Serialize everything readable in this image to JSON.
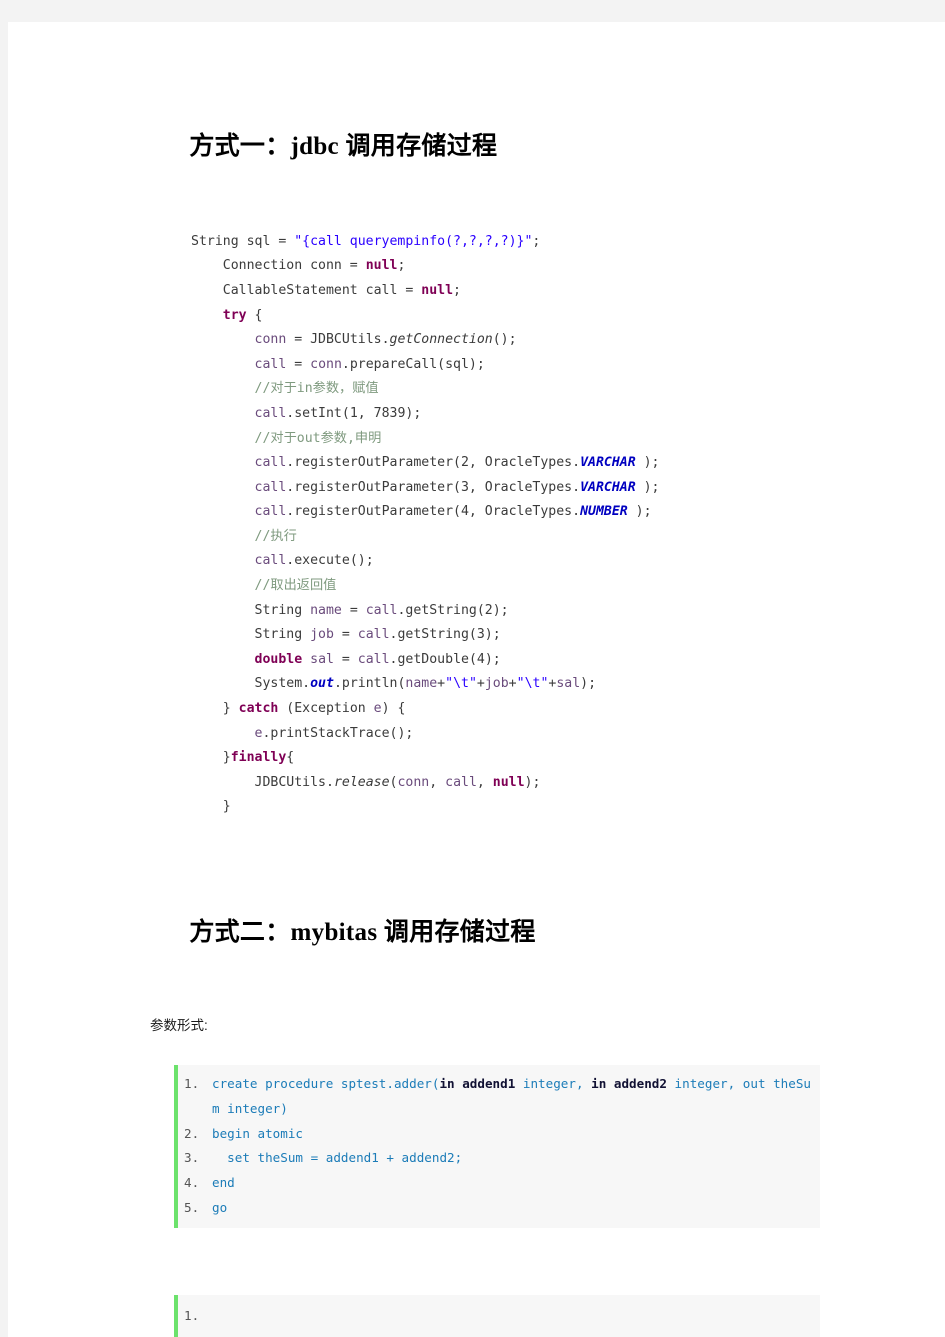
{
  "document": {
    "background_color": "#f3f3f3",
    "page_color": "#ffffff"
  },
  "headings": {
    "heading_1_prefix": "方式一：",
    "heading_1_code": "jdbc",
    "heading_1_suffix": " 调用存储过程",
    "heading_2_prefix": "方式二：",
    "heading_2_code": "mybitas",
    "heading_2_suffix": " 调用存储过程"
  },
  "paragraphs": {
    "params_label": "参数形式:"
  },
  "java_block": {
    "language": "java",
    "lines": [
      {
        "indent": 0,
        "tokens": [
          {
            "t": "String sql = ",
            "c": "plain"
          },
          {
            "t": "\"{call queryempinfo(?,?,?,?)}\"",
            "c": "str"
          },
          {
            "t": ";",
            "c": "plain"
          }
        ]
      },
      {
        "indent": 1,
        "tokens": [
          {
            "t": "Connection conn = ",
            "c": "plain"
          },
          {
            "t": "null",
            "c": "kw"
          },
          {
            "t": ";",
            "c": "plain"
          }
        ]
      },
      {
        "indent": 1,
        "tokens": [
          {
            "t": "CallableStatement call = ",
            "c": "plain"
          },
          {
            "t": "null",
            "c": "kw"
          },
          {
            "t": ";",
            "c": "plain"
          }
        ]
      },
      {
        "indent": 1,
        "tokens": [
          {
            "t": "try",
            "c": "kw"
          },
          {
            "t": " {",
            "c": "plain"
          }
        ]
      },
      {
        "indent": 2,
        "tokens": [
          {
            "t": "conn",
            "c": "lvar"
          },
          {
            "t": " = JDBCUtils.",
            "c": "plain"
          },
          {
            "t": "getConnection",
            "c": "mth"
          },
          {
            "t": "();",
            "c": "plain"
          }
        ]
      },
      {
        "indent": 2,
        "tokens": [
          {
            "t": "call",
            "c": "lvar"
          },
          {
            "t": " = ",
            "c": "plain"
          },
          {
            "t": "conn",
            "c": "lvar"
          },
          {
            "t": ".prepareCall(sql);",
            "c": "plain"
          }
        ]
      },
      {
        "indent": 2,
        "tokens": [
          {
            "t": "//对于in参数，赋值",
            "c": "cmt"
          }
        ]
      },
      {
        "indent": 2,
        "tokens": [
          {
            "t": "call",
            "c": "lvar"
          },
          {
            "t": ".setInt(1, 7839);",
            "c": "plain"
          }
        ]
      },
      {
        "indent": 2,
        "tokens": [
          {
            "t": "//对于out参数,申明",
            "c": "cmt"
          }
        ]
      },
      {
        "indent": 2,
        "tokens": [
          {
            "t": "call",
            "c": "lvar"
          },
          {
            "t": ".registerOutParameter(2, OracleTypes.",
            "c": "plain"
          },
          {
            "t": "VARCHAR",
            "c": "stat"
          },
          {
            "t": " );",
            "c": "plain"
          }
        ]
      },
      {
        "indent": 2,
        "tokens": [
          {
            "t": "call",
            "c": "lvar"
          },
          {
            "t": ".registerOutParameter(3, OracleTypes.",
            "c": "plain"
          },
          {
            "t": "VARCHAR",
            "c": "stat"
          },
          {
            "t": " );",
            "c": "plain"
          }
        ]
      },
      {
        "indent": 2,
        "tokens": [
          {
            "t": "call",
            "c": "lvar"
          },
          {
            "t": ".registerOutParameter(4, OracleTypes.",
            "c": "plain"
          },
          {
            "t": "NUMBER",
            "c": "stat"
          },
          {
            "t": " );",
            "c": "plain"
          }
        ]
      },
      {
        "indent": 2,
        "tokens": [
          {
            "t": "//执行",
            "c": "cmt"
          }
        ]
      },
      {
        "indent": 2,
        "tokens": [
          {
            "t": "call",
            "c": "lvar"
          },
          {
            "t": ".execute();",
            "c": "plain"
          }
        ]
      },
      {
        "indent": 2,
        "tokens": [
          {
            "t": "//取出返回值",
            "c": "cmt"
          }
        ]
      },
      {
        "indent": 2,
        "tokens": [
          {
            "t": "String ",
            "c": "plain"
          },
          {
            "t": "name",
            "c": "lvar"
          },
          {
            "t": " = ",
            "c": "plain"
          },
          {
            "t": "call",
            "c": "lvar"
          },
          {
            "t": ".getString(2);",
            "c": "plain"
          }
        ]
      },
      {
        "indent": 2,
        "tokens": [
          {
            "t": "String ",
            "c": "plain"
          },
          {
            "t": "job",
            "c": "lvar"
          },
          {
            "t": " = ",
            "c": "plain"
          },
          {
            "t": "call",
            "c": "lvar"
          },
          {
            "t": ".getString(3);",
            "c": "plain"
          }
        ]
      },
      {
        "indent": 2,
        "tokens": [
          {
            "t": "double",
            "c": "kw"
          },
          {
            "t": " ",
            "c": "plain"
          },
          {
            "t": "sal",
            "c": "lvar"
          },
          {
            "t": " = ",
            "c": "plain"
          },
          {
            "t": "call",
            "c": "lvar"
          },
          {
            "t": ".getDouble(4);",
            "c": "plain"
          }
        ]
      },
      {
        "indent": 2,
        "tokens": [
          {
            "t": "System.",
            "c": "plain"
          },
          {
            "t": "out",
            "c": "stat"
          },
          {
            "t": ".println(",
            "c": "plain"
          },
          {
            "t": "name",
            "c": "lvar"
          },
          {
            "t": "+",
            "c": "plain"
          },
          {
            "t": "\"\\t\"",
            "c": "str"
          },
          {
            "t": "+",
            "c": "plain"
          },
          {
            "t": "job",
            "c": "lvar"
          },
          {
            "t": "+",
            "c": "plain"
          },
          {
            "t": "\"\\t\"",
            "c": "str"
          },
          {
            "t": "+",
            "c": "plain"
          },
          {
            "t": "sal",
            "c": "lvar"
          },
          {
            "t": ");",
            "c": "plain"
          }
        ]
      },
      {
        "indent": 1,
        "tokens": [
          {
            "t": "} ",
            "c": "plain"
          },
          {
            "t": "catch",
            "c": "kw"
          },
          {
            "t": " (Exception ",
            "c": "plain"
          },
          {
            "t": "e",
            "c": "lvar"
          },
          {
            "t": ") {",
            "c": "plain"
          }
        ]
      },
      {
        "indent": 2,
        "tokens": [
          {
            "t": "e",
            "c": "lvar"
          },
          {
            "t": ".printStackTrace();",
            "c": "plain"
          }
        ]
      },
      {
        "indent": 1,
        "tokens": [
          {
            "t": "}",
            "c": "plain"
          },
          {
            "t": "finally",
            "c": "kw"
          },
          {
            "t": "{",
            "c": "plain"
          }
        ]
      },
      {
        "indent": 2,
        "tokens": [
          {
            "t": "JDBCUtils.",
            "c": "plain"
          },
          {
            "t": "release",
            "c": "mth"
          },
          {
            "t": "(",
            "c": "plain"
          },
          {
            "t": "conn",
            "c": "lvar"
          },
          {
            "t": ", ",
            "c": "plain"
          },
          {
            "t": "call",
            "c": "lvar"
          },
          {
            "t": ", ",
            "c": "plain"
          },
          {
            "t": "null",
            "c": "kw"
          },
          {
            "t": ");",
            "c": "plain"
          }
        ]
      },
      {
        "indent": 1,
        "tokens": [
          {
            "t": "}",
            "c": "plain"
          }
        ]
      }
    ]
  },
  "sql_block": {
    "accent_color": "#6ce26c",
    "background_color": "#f7f7f7",
    "code_color": "#1c7cb8",
    "rows": [
      {
        "num": "1.",
        "tokens": [
          {
            "t": "create procedure sptest.adder(",
            "c": ""
          },
          {
            "t": "in addend1",
            "c": "sqlkw"
          },
          {
            "t": " integer, ",
            "c": ""
          },
          {
            "t": "in addend2",
            "c": "sqlkw"
          },
          {
            "t": " integer, out theSum integer)",
            "c": ""
          }
        ]
      },
      {
        "num": "2.",
        "tokens": [
          {
            "t": "begin atomic",
            "c": ""
          }
        ]
      },
      {
        "num": "3.",
        "tokens": [
          {
            "t": "  set theSum = addend1 + addend2;",
            "c": ""
          }
        ]
      },
      {
        "num": "4.",
        "tokens": [
          {
            "t": "end",
            "c": ""
          }
        ]
      },
      {
        "num": "5.",
        "tokens": [
          {
            "t": "go",
            "c": ""
          }
        ]
      }
    ]
  },
  "sql_block_empty": {
    "accent_color": "#6ce26c",
    "background_color": "#f7f7f7",
    "rows": [
      {
        "num": "1.",
        "tokens": [
          {
            "t": "",
            "c": ""
          }
        ]
      }
    ]
  }
}
